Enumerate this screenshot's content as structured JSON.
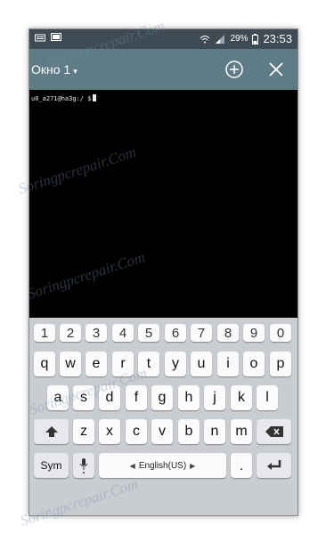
{
  "status": {
    "battery": "29%",
    "time": "23:53"
  },
  "toolbar": {
    "title": "Окно 1"
  },
  "terminal": {
    "prompt": "u0_a271@ha3g:/ $"
  },
  "keyboard": {
    "numbers": [
      "1",
      "2",
      "3",
      "4",
      "5",
      "6",
      "7",
      "8",
      "9",
      "0"
    ],
    "row1": [
      "q",
      "w",
      "e",
      "r",
      "t",
      "y",
      "u",
      "i",
      "o",
      "p"
    ],
    "row2": [
      "a",
      "s",
      "d",
      "f",
      "g",
      "h",
      "j",
      "k",
      "l"
    ],
    "row3": [
      "z",
      "x",
      "c",
      "v",
      "b",
      "n",
      "m"
    ],
    "sym": "Sym",
    "space": "English(US)",
    "dot": "."
  },
  "watermark": "Soringpcrepair.Com"
}
